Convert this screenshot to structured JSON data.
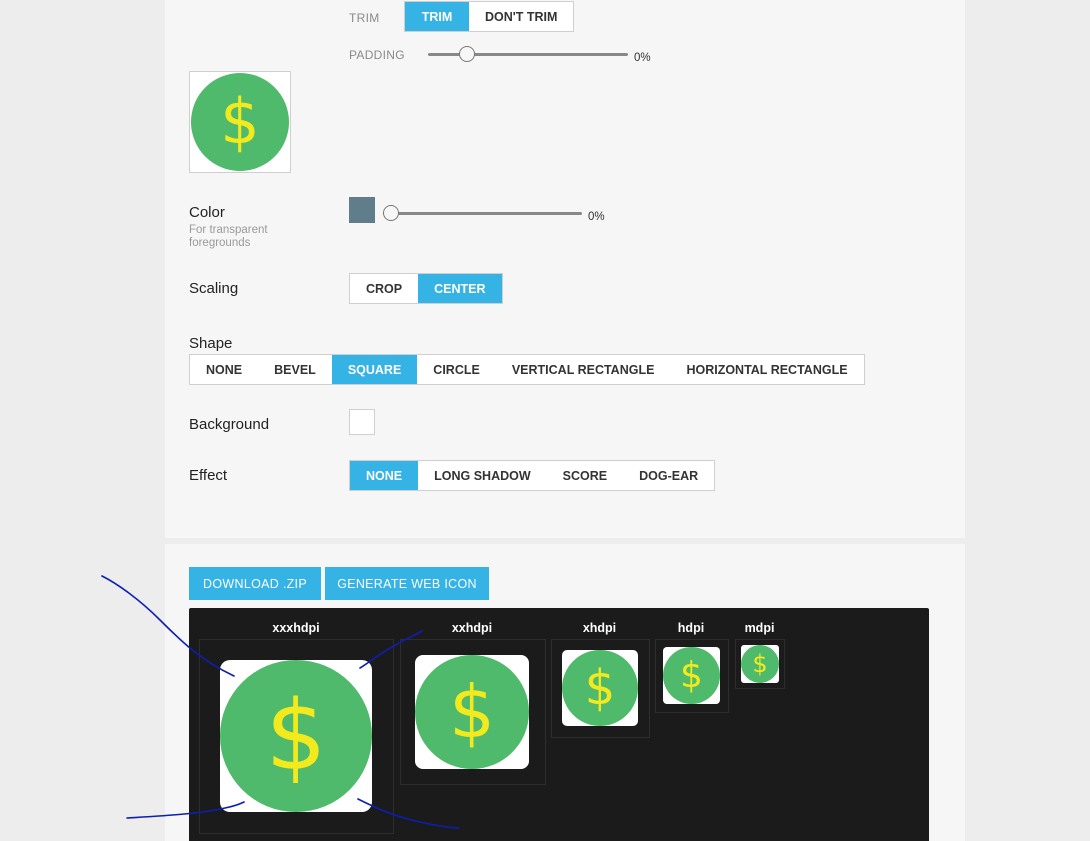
{
  "trim": {
    "label": "TRIM",
    "options": [
      "TRIM",
      "DON'T TRIM"
    ],
    "selected": "TRIM"
  },
  "padding": {
    "label": "PADDING",
    "value_text": "0%",
    "value": 0
  },
  "color": {
    "label": "Color",
    "sublabel": "For transparent foregrounds",
    "swatch": "#607d8b",
    "value_text": "0%",
    "value": 0
  },
  "scaling": {
    "label": "Scaling",
    "options": [
      "CROP",
      "CENTER"
    ],
    "selected": "CENTER"
  },
  "shape": {
    "label": "Shape",
    "options": [
      "NONE",
      "BEVEL",
      "SQUARE",
      "CIRCLE",
      "VERTICAL RECTANGLE",
      "HORIZONTAL RECTANGLE"
    ],
    "selected": "SQUARE"
  },
  "background": {
    "label": "Background",
    "swatch": "#ffffff"
  },
  "effect": {
    "label": "Effect",
    "options": [
      "NONE",
      "LONG SHADOW",
      "SCORE",
      "DOG-EAR"
    ],
    "selected": "NONE"
  },
  "actions": {
    "download": "DOWNLOAD .ZIP",
    "generate": "GENERATE WEB ICON"
  },
  "icon": {
    "glyph": "$",
    "name": "dollar-icon",
    "circle_color": "#4fba6b",
    "glyph_color": "#f3ea1e"
  },
  "densities": [
    "xxxhdpi",
    "xxhdpi",
    "xhdpi",
    "hdpi",
    "mdpi"
  ],
  "colors": {
    "accent": "#35b3e5",
    "panel": "#1b1b1b",
    "annotation": "#0d1fb3"
  }
}
